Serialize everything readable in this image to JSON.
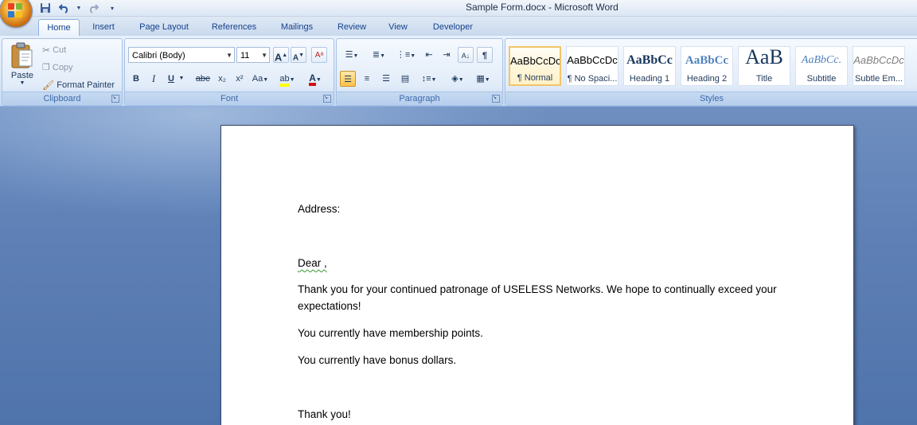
{
  "window": {
    "title": "Sample Form.docx - Microsoft Word"
  },
  "quick_access": [
    "save-icon",
    "undo-icon",
    "redo-icon",
    "customize-icon"
  ],
  "tabs": [
    {
      "label": "Home",
      "active": true
    },
    {
      "label": "Insert"
    },
    {
      "label": "Page Layout"
    },
    {
      "label": "References"
    },
    {
      "label": "Mailings"
    },
    {
      "label": "Review"
    },
    {
      "label": "View"
    },
    {
      "label": "Developer"
    }
  ],
  "clipboard": {
    "paste": "Paste",
    "cut": "Cut",
    "copy": "Copy",
    "format_painter": "Format Painter",
    "label": "Clipboard"
  },
  "font": {
    "name": "Calibri (Body)",
    "size": "11",
    "label": "Font",
    "bold": "B",
    "italic": "I",
    "underline": "U",
    "strike": "abe",
    "subscript": "x₂",
    "superscript": "x²",
    "change_case": "Aa",
    "grow": "A",
    "shrink": "A",
    "font_color": "A"
  },
  "paragraph": {
    "label": "Paragraph"
  },
  "styles": {
    "label": "Styles",
    "items": [
      {
        "sample": "AaBbCcDc",
        "name": "¶ Normal",
        "selected": true
      },
      {
        "sample": "AaBbCcDc",
        "name": "¶ No Spaci..."
      },
      {
        "sample": "AaBbCc",
        "name": "Heading 1"
      },
      {
        "sample": "AaBbCc",
        "name": "Heading 2"
      },
      {
        "sample": "AaB",
        "name": "Title"
      },
      {
        "sample": "AaBbCc.",
        "name": "Subtitle"
      },
      {
        "sample": "AaBbCcDc",
        "name": "Subtle Em..."
      }
    ]
  },
  "document": {
    "lines": [
      "Address:",
      "Dear ,",
      "Thank you for your continued patronage of USELESS Networks.  We hope to continually exceed your",
      "expectations!",
      "You currently have membership points.",
      "You currently have bonus dollars.",
      "Thank you!"
    ]
  },
  "colors": {
    "accent": "#15428b",
    "workspace": "#5d7fb3",
    "highlight": "#ffff00",
    "font_color": "#d01010"
  }
}
